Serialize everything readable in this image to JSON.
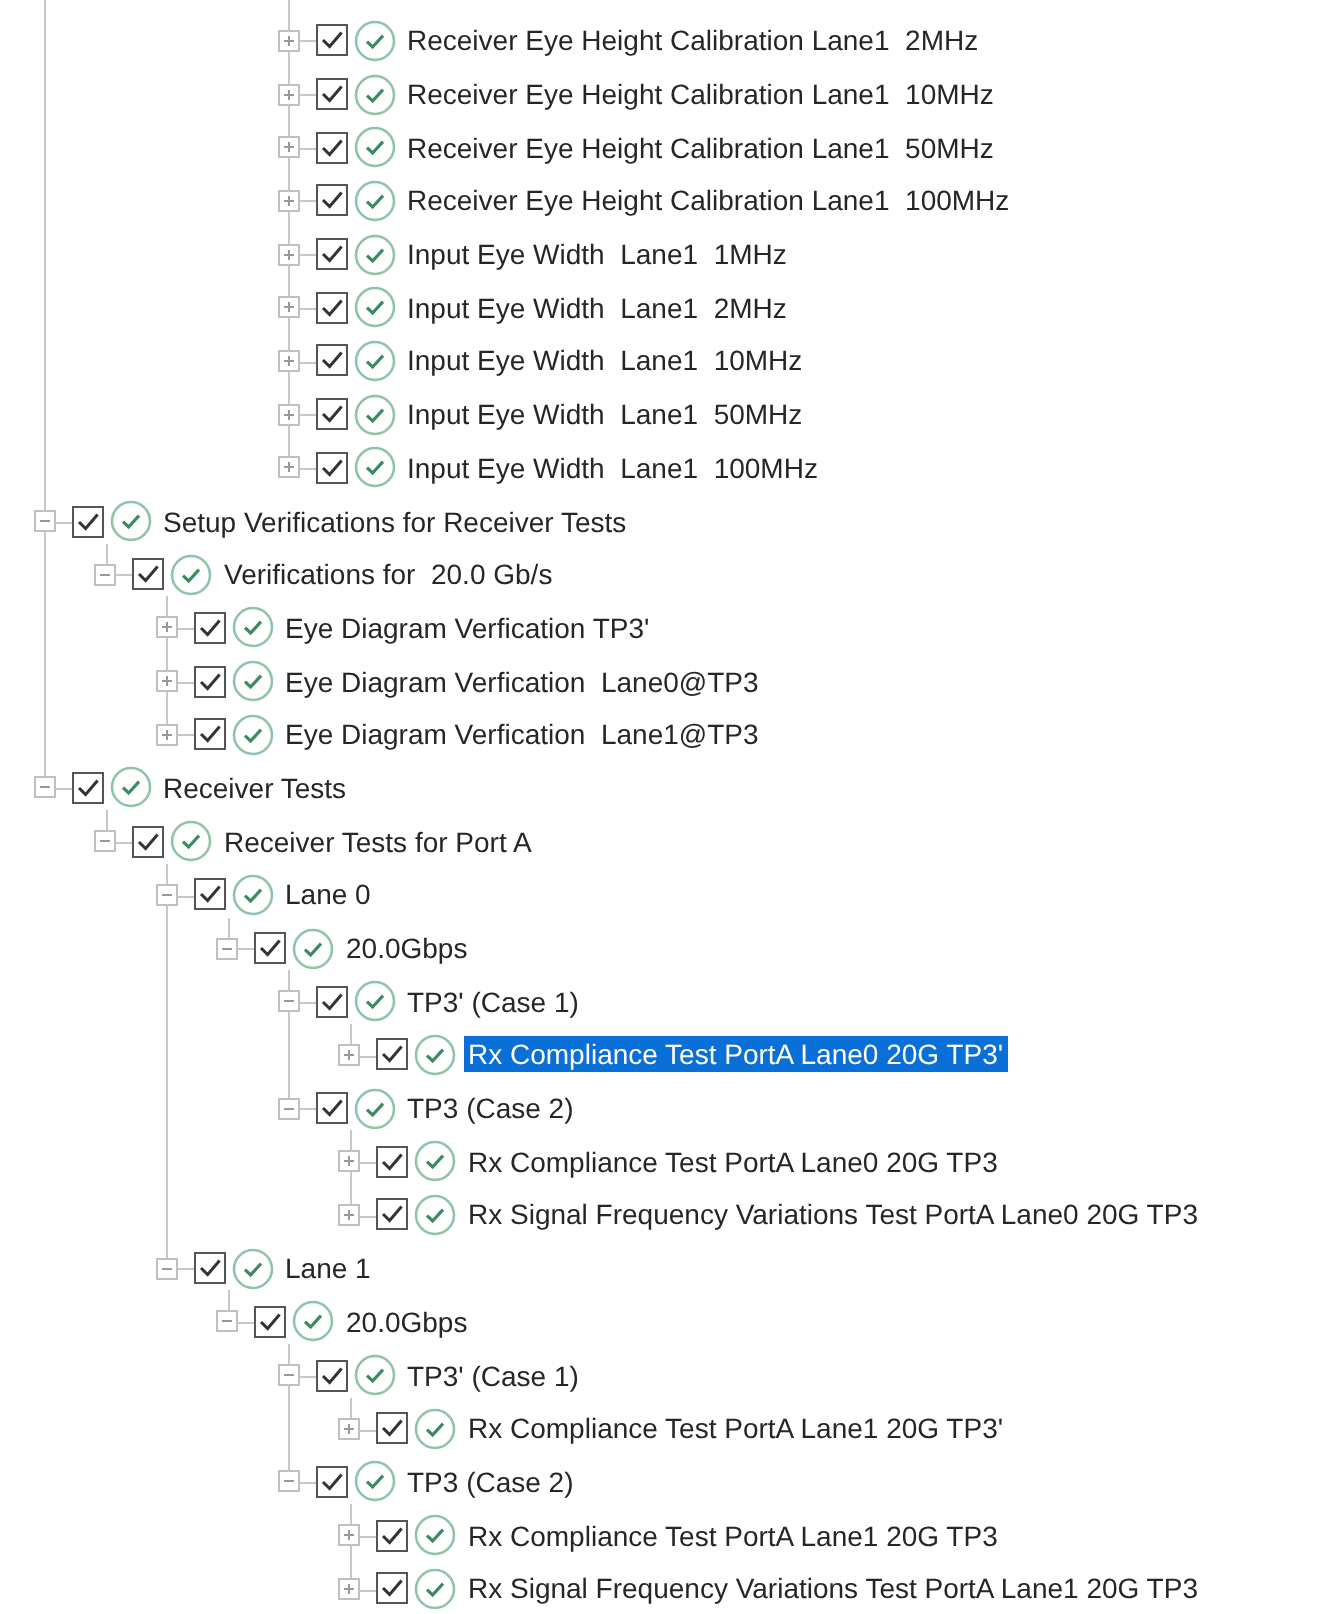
{
  "partial_branch": [
    {
      "label": "Receiver Eye Height Calibration Lane1  2MHz",
      "checked": true,
      "passed": true,
      "expanded": false,
      "selected": false
    },
    {
      "label": "Receiver Eye Height Calibration Lane1  10MHz",
      "checked": true,
      "passed": true,
      "expanded": false,
      "selected": false
    },
    {
      "label": "Receiver Eye Height Calibration Lane1  50MHz",
      "checked": true,
      "passed": true,
      "expanded": false,
      "selected": false
    },
    {
      "label": "Receiver Eye Height Calibration Lane1  100MHz",
      "checked": true,
      "passed": true,
      "expanded": false,
      "selected": false
    },
    {
      "label": "Input Eye Width  Lane1  1MHz",
      "checked": true,
      "passed": true,
      "expanded": false,
      "selected": false
    },
    {
      "label": "Input Eye Width  Lane1  2MHz",
      "checked": true,
      "passed": true,
      "expanded": false,
      "selected": false
    },
    {
      "label": "Input Eye Width  Lane1  10MHz",
      "checked": true,
      "passed": true,
      "expanded": false,
      "selected": false
    },
    {
      "label": "Input Eye Width  Lane1  50MHz",
      "checked": true,
      "passed": true,
      "expanded": false,
      "selected": false
    },
    {
      "label": "Input Eye Width  Lane1  100MHz",
      "checked": true,
      "passed": true,
      "expanded": false,
      "selected": false
    }
  ],
  "tree": [
    {
      "label": "Setup Verifications for Receiver Tests",
      "checked": true,
      "passed": true,
      "expanded": true,
      "selected": false,
      "children": [
        {
          "label": "Verifications for  20.0 Gb/s",
          "checked": true,
          "passed": true,
          "expanded": true,
          "selected": false,
          "children": [
            {
              "label": "Eye Diagram Verfication TP3'",
              "checked": true,
              "passed": true,
              "expanded": false,
              "selected": false
            },
            {
              "label": "Eye Diagram Verfication  Lane0@TP3",
              "checked": true,
              "passed": true,
              "expanded": false,
              "selected": false
            },
            {
              "label": "Eye Diagram Verfication  Lane1@TP3",
              "checked": true,
              "passed": true,
              "expanded": false,
              "selected": false
            }
          ]
        }
      ]
    },
    {
      "label": "Receiver Tests",
      "checked": true,
      "passed": true,
      "expanded": true,
      "selected": false,
      "children": [
        {
          "label": "Receiver Tests for Port A",
          "checked": true,
          "passed": true,
          "expanded": true,
          "selected": false,
          "children": [
            {
              "label": "Lane 0",
              "checked": true,
              "passed": true,
              "expanded": true,
              "selected": false,
              "children": [
                {
                  "label": "20.0Gbps",
                  "checked": true,
                  "passed": true,
                  "expanded": true,
                  "selected": false,
                  "children": [
                    {
                      "label": "TP3' (Case 1)",
                      "checked": true,
                      "passed": true,
                      "expanded": true,
                      "selected": false,
                      "children": [
                        {
                          "label": "Rx Compliance Test PortA Lane0 20G TP3'",
                          "checked": true,
                          "passed": true,
                          "expanded": false,
                          "selected": true
                        }
                      ]
                    },
                    {
                      "label": "TP3 (Case 2)",
                      "checked": true,
                      "passed": true,
                      "expanded": true,
                      "selected": false,
                      "children": [
                        {
                          "label": "Rx Compliance Test PortA Lane0 20G TP3",
                          "checked": true,
                          "passed": true,
                          "expanded": false,
                          "selected": false
                        },
                        {
                          "label": "Rx Signal Frequency Variations Test PortA Lane0 20G TP3",
                          "checked": true,
                          "passed": true,
                          "expanded": false,
                          "selected": false
                        }
                      ]
                    }
                  ]
                }
              ]
            },
            {
              "label": "Lane 1",
              "checked": true,
              "passed": true,
              "expanded": true,
              "selected": false,
              "children": [
                {
                  "label": "20.0Gbps",
                  "checked": true,
                  "passed": true,
                  "expanded": true,
                  "selected": false,
                  "children": [
                    {
                      "label": "TP3' (Case 1)",
                      "checked": true,
                      "passed": true,
                      "expanded": true,
                      "selected": false,
                      "children": [
                        {
                          "label": "Rx Compliance Test PortA Lane1 20G TP3'",
                          "checked": true,
                          "passed": true,
                          "expanded": false,
                          "selected": false
                        }
                      ]
                    },
                    {
                      "label": "TP3 (Case 2)",
                      "checked": true,
                      "passed": true,
                      "expanded": true,
                      "selected": false,
                      "children": [
                        {
                          "label": "Rx Compliance Test PortA Lane1 20G TP3",
                          "checked": true,
                          "passed": true,
                          "expanded": false,
                          "selected": false
                        },
                        {
                          "label": "Rx Signal Frequency Variations Test PortA Lane1 20G TP3",
                          "checked": true,
                          "passed": true,
                          "expanded": false,
                          "selected": false
                        }
                      ]
                    }
                  ]
                }
              ]
            }
          ]
        }
      ]
    }
  ]
}
